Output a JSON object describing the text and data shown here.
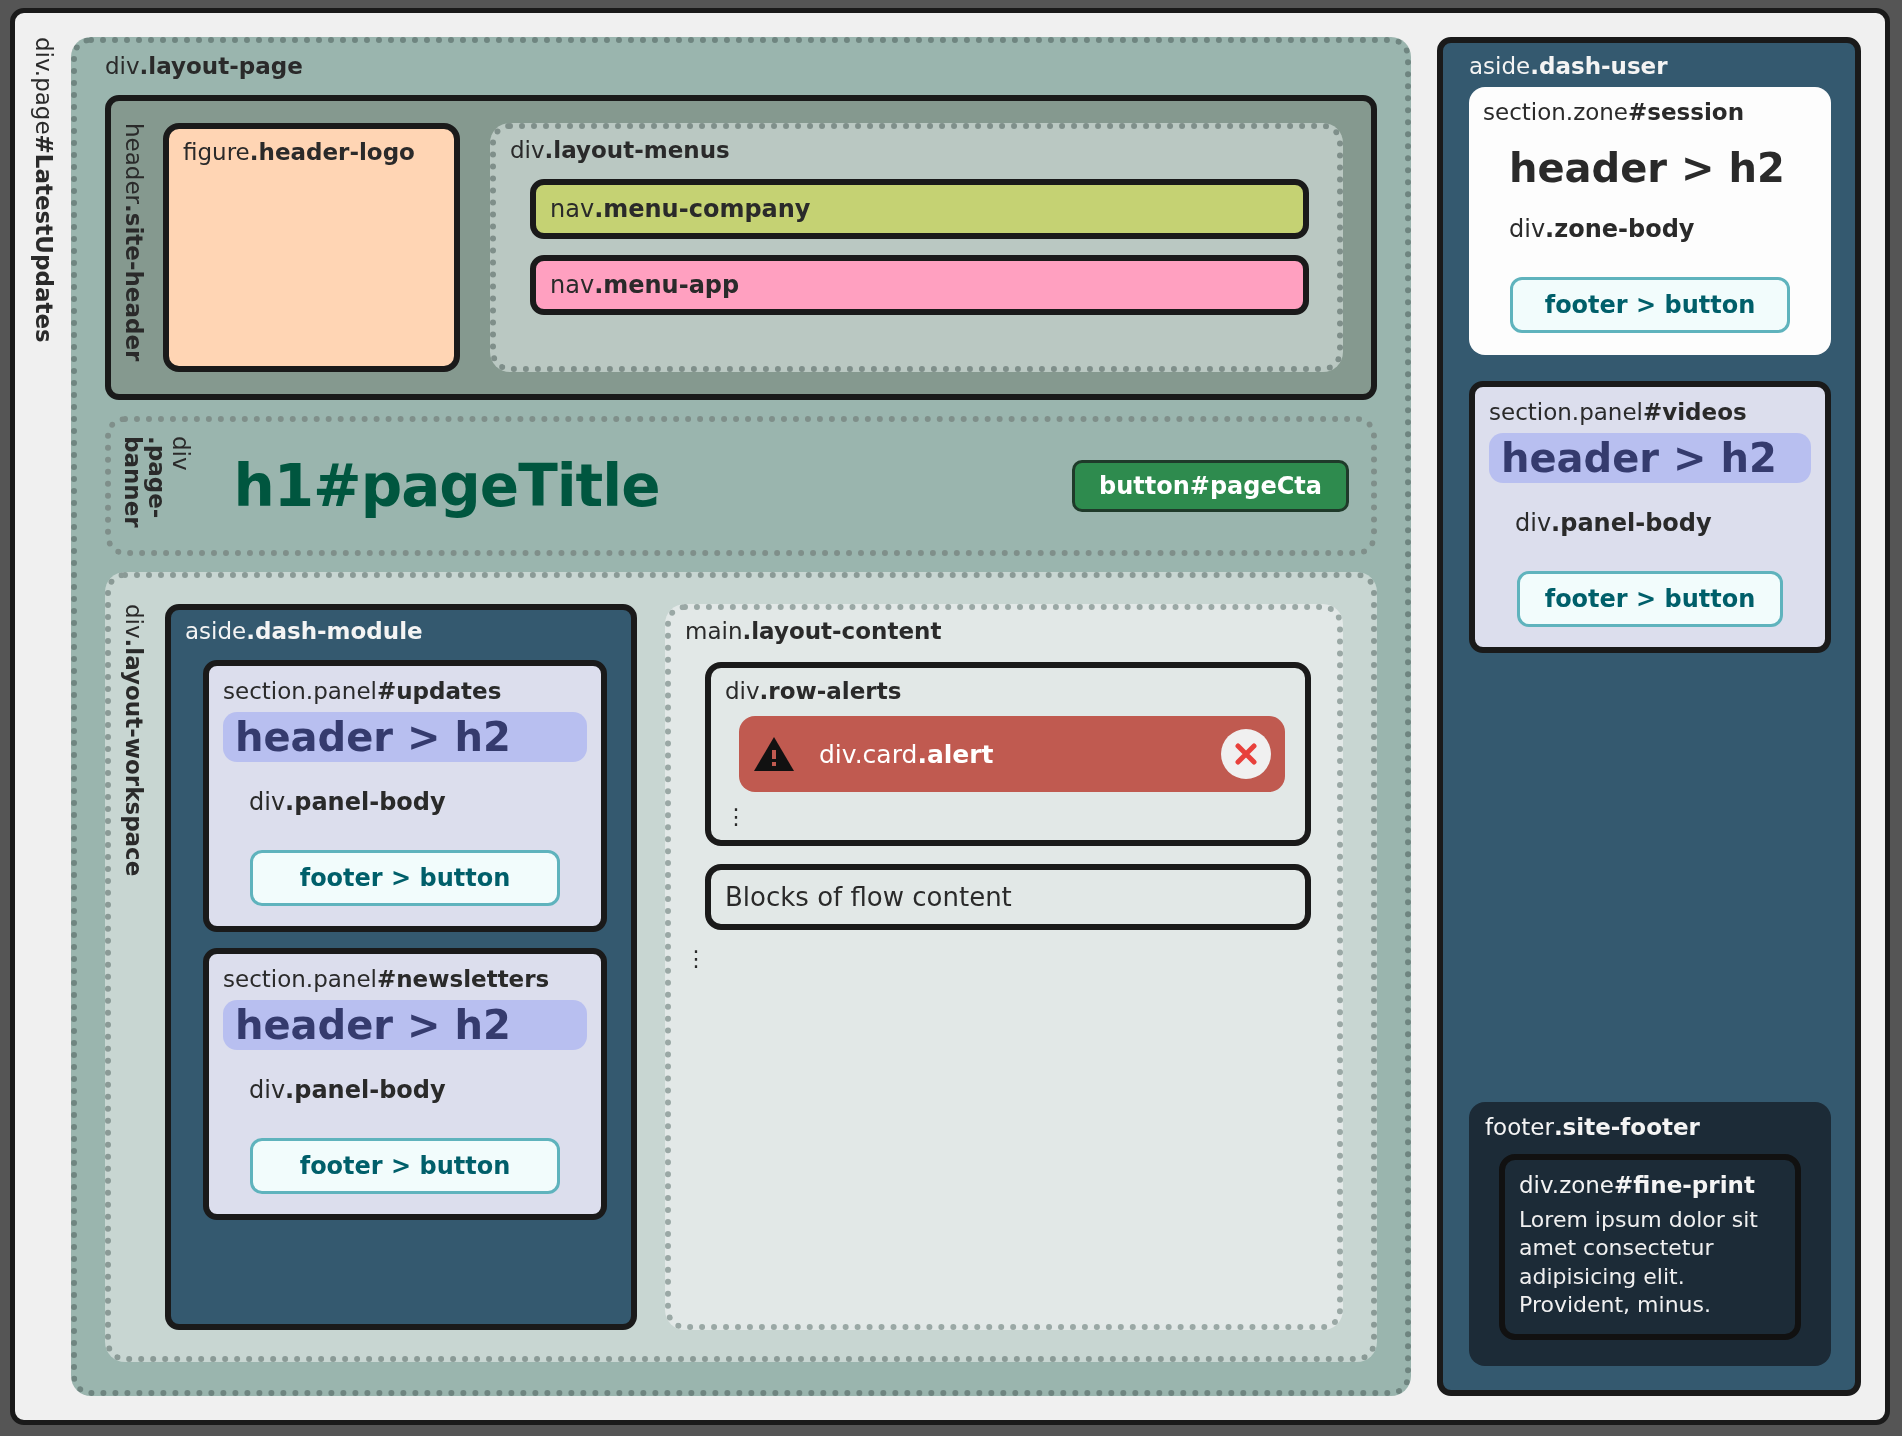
{
  "page": {
    "label": "div.page**#LatestUpdates**"
  },
  "layout_page": {
    "label": "div**.layout-page**",
    "site_header": {
      "label": "header**.site-header**",
      "logo": {
        "label": "figure**.header-logo**"
      },
      "menus": {
        "label": "div**.layout-menus**",
        "items": [
          {
            "label": "nav**.menu-company**",
            "color": "#c5d273"
          },
          {
            "label": "nav**.menu-app**",
            "color": "#ffa0c0"
          }
        ]
      }
    },
    "page_banner": {
      "label": "div **.page-banner**",
      "title": "h1#pageTitle",
      "button": "button#pageCta"
    },
    "workspace": {
      "label": "div**.layout-workspace**",
      "dash_module": {
        "label": "aside**.dash-module**",
        "panels": [
          {
            "label": "section.panel**#updates**",
            "heading": "header > h2",
            "body": "div**.panel-body**",
            "button": "footer > button"
          },
          {
            "label": "section.panel**#newsletters**",
            "heading": "header > h2",
            "body": "div**.panel-body**",
            "button": "footer > button"
          }
        ]
      },
      "content": {
        "label": "main**.layout-content**",
        "row_alerts": {
          "label": "div**.row-alerts**",
          "alert": {
            "label": "div.card**.alert**"
          },
          "more": "⋮"
        },
        "blocks": "Blocks of flow content",
        "more": "⋮"
      }
    }
  },
  "dash_user": {
    "label": "aside**.dash-user**",
    "session": {
      "label": "section.zone**#session**",
      "heading": "header > h2",
      "body": "div**.zone-body**",
      "button": "footer > button"
    },
    "videos": {
      "label": "section.panel**#videos**",
      "heading": "header > h2",
      "body": "div**.panel-body**",
      "button": "footer > button"
    },
    "site_footer": {
      "label": "footer**.site-footer**",
      "fine_print": {
        "label": "div.zone**#fine-print**",
        "text": "Lorem ipsum dolor sit amet consectetur adipisicing elit. Provident, minus."
      }
    }
  }
}
